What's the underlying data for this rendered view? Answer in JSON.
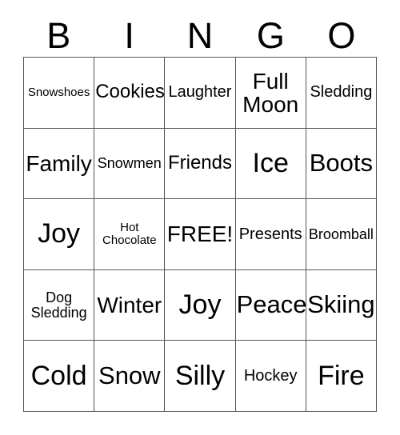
{
  "card": {
    "header_letters": [
      "B",
      "I",
      "N",
      "G",
      "O"
    ],
    "border_color": "#555555",
    "background_color": "#ffffff",
    "text_color": "#000000",
    "grid_size": "5x5",
    "free_space_label": "FREE!",
    "cells": [
      {
        "text": "Snowshoes",
        "size": "xxs",
        "lines": 1
      },
      {
        "text": "Cookies",
        "size": "md",
        "lines": 1
      },
      {
        "text": "Laughter",
        "size": "sm",
        "lines": 1
      },
      {
        "text": "Full\nMoon",
        "size": "lg",
        "lines": 2
      },
      {
        "text": "Sledding",
        "size": "sm",
        "lines": 1
      },
      {
        "text": "Family",
        "size": "lg",
        "lines": 1
      },
      {
        "text": "Snowmen",
        "size": "xs",
        "lines": 1
      },
      {
        "text": "Friends",
        "size": "md",
        "lines": 1
      },
      {
        "text": "Ice",
        "size": "xxl",
        "lines": 1
      },
      {
        "text": "Boots",
        "size": "xl",
        "lines": 1
      },
      {
        "text": "Joy",
        "size": "xxl",
        "lines": 1
      },
      {
        "text": "Hot\nChocolate",
        "size": "xxs",
        "lines": 2
      },
      {
        "text": "FREE!",
        "size": "lg",
        "lines": 1
      },
      {
        "text": "Presents",
        "size": "sm",
        "lines": 1
      },
      {
        "text": "Broomball",
        "size": "xs",
        "lines": 1
      },
      {
        "text": "Dog\nSledding",
        "size": "xs",
        "lines": 2
      },
      {
        "text": "Winter",
        "size": "lg",
        "lines": 1
      },
      {
        "text": "Joy",
        "size": "xxl",
        "lines": 1
      },
      {
        "text": "Peace",
        "size": "xl",
        "lines": 1
      },
      {
        "text": "Skiing",
        "size": "xl",
        "lines": 1
      },
      {
        "text": "Cold",
        "size": "xxl",
        "lines": 1
      },
      {
        "text": "Snow",
        "size": "xl",
        "lines": 1
      },
      {
        "text": "Silly",
        "size": "xxl",
        "lines": 1
      },
      {
        "text": "Hockey",
        "size": "sm",
        "lines": 1
      },
      {
        "text": "Fire",
        "size": "xxl",
        "lines": 1
      }
    ]
  }
}
